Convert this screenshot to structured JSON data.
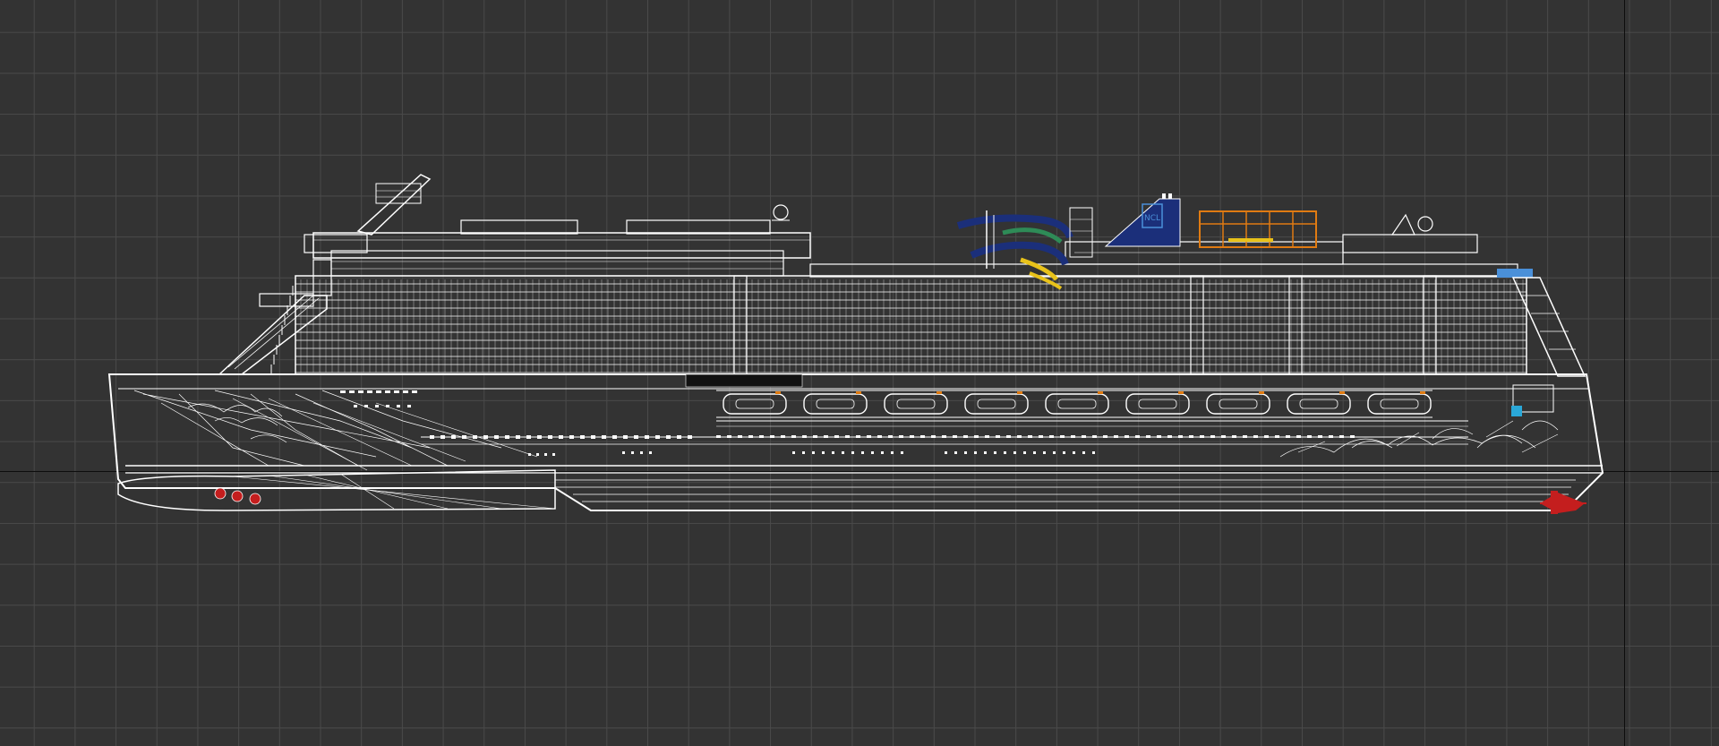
{
  "viewport": {
    "background": "#333333",
    "grid_color": "#4a4a4a",
    "axis_color": "#0d0d0d",
    "wireframe_color": "#ffffff"
  },
  "model": {
    "funnel_logo_text": "NCL",
    "funnel_color": "#1b2f7a",
    "waterslide_colors": [
      "#1b2f7a",
      "#2e8b57",
      "#e8c21a"
    ],
    "ropes_course_color": "#e07b12",
    "bow_thruster_color": "#c41e1e",
    "stern_screw_color": "#c41e1e",
    "accent_blue": "#4a90d9"
  }
}
